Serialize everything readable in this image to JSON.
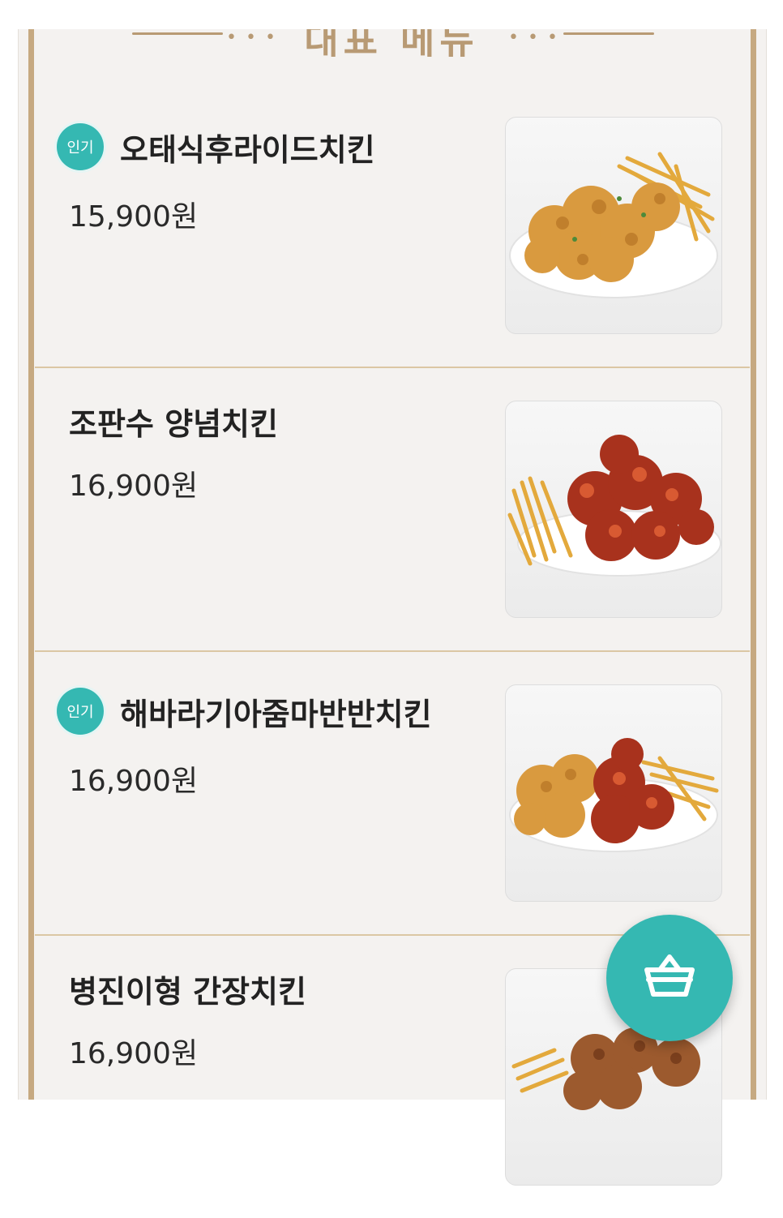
{
  "header": {
    "title": "대표 메뉴"
  },
  "menu": {
    "items": [
      {
        "name": "오태식후라이드치킨",
        "price": "15,900원",
        "badge": "인기",
        "photo_icon": "fried-chicken-photo"
      },
      {
        "name": "조판수 양념치킨",
        "price": "16,900원",
        "photo_icon": "seasoned-chicken-photo"
      },
      {
        "name": "해바라기아줌마반반치킨",
        "price": "16,900원",
        "badge": "인기",
        "photo_icon": "half-half-chicken-photo"
      },
      {
        "name": "병진이형 간장치킨",
        "price": "16,900원",
        "photo_icon": "soy-chicken-photo"
      }
    ]
  },
  "cart": {
    "icon": "basket-icon"
  },
  "colors": {
    "accent": "#35b8b2",
    "frame": "#c6a981",
    "divider": "#dbc7a4",
    "background": "#f4f2f0"
  }
}
